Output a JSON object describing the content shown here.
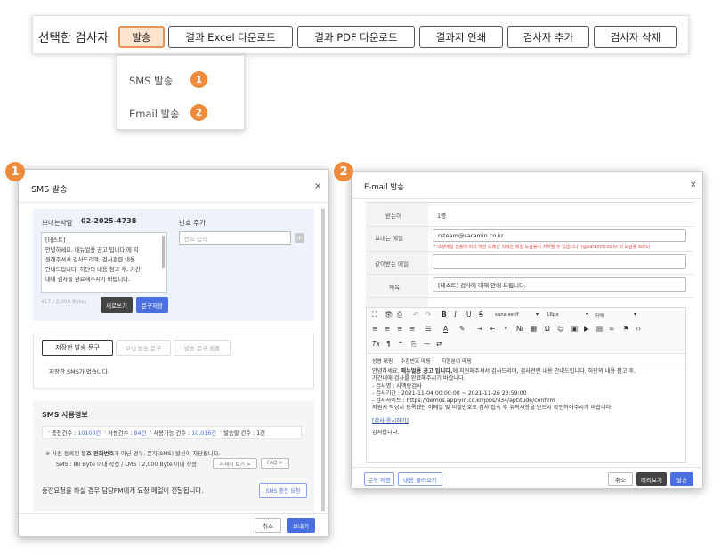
{
  "toolbar": {
    "label": "선택한 검사자",
    "buttons": [
      "발송",
      "결과 Excel 다운로드",
      "결과 PDF 다운로드",
      "결과지 인쇄",
      "검사자 추가",
      "검사자 삭제"
    ]
  },
  "send_menu": {
    "items": [
      {
        "label": "SMS 발송",
        "badge": "1"
      },
      {
        "label": "Email 발송",
        "badge": "2"
      }
    ]
  },
  "sms_dialog": {
    "badge": "1",
    "title": "SMS 발송",
    "close": "×",
    "sender_label": "보내는사람",
    "sender_number": "02-2025-4738",
    "message_lines": [
      "[테스트]",
      "안녕하세요, 매뉴얼용 공고 입니다.에 지",
      "원해주셔서 감사드리며, 검사관련 내용",
      "안내드립니다. 하단의 내용 참고 후, 기간",
      "내에 검사를 완료해주시기 바랍니다."
    ],
    "byte_count": "417 / 2,000 Bytes",
    "new_btn": "새로쓰기",
    "save_btn": "문구저장",
    "number_add_label": "번호 추가",
    "number_placeholder": "번호 입력",
    "add_icon": "+",
    "tabs": [
      "저장한 발송 문구",
      "보낸 발송 문구",
      "발송 문구 샘플"
    ],
    "no_saved": "저장한 SMS가 없습니다.",
    "info_title": "SMS 사용정보",
    "usage": {
      "charged_label": "충전건수 :",
      "charged": "10100건",
      "used_label": "사용건수 :",
      "used": "84건",
      "avail_label": "사용가능 건수 :",
      "avail": "10,016건",
      "send_label": "발송할 건수 :",
      "send": "1건"
    },
    "note_prefix": "※ 사전 등록된 ",
    "note_bold": "유효 전화번호",
    "note_suffix": "가 아닌 경우, 문자(SMS) 발신이 차단됩니다.",
    "note_line2": "SMS : 80 Byte 이내 작성 / LMS : 2,000 Byte 이내 작성",
    "detail_btn": "자세히 보기 >",
    "faq_btn": "FAQ >",
    "charge_text": "충전요청을 하실 경우 담당PM에게 요청 메일이 전달됩니다.",
    "charge_btn": "SMS 충전 요청",
    "cancel": "취소",
    "send": "보내기"
  },
  "email_dialog": {
    "badge": "2",
    "title": "E-mail 발송",
    "close": "×",
    "recipient_label": "받는이",
    "recipient_value": "1명",
    "from_label": "보내는 메일",
    "from_value": "rsteam@saramin.co.kr",
    "from_warning": "* 대량메일 전송에 따라 해당 도메인 외에는 메일 도달률이 저하될 수 있습니다. (@saramin.co.kr 외 도달률 60%)",
    "cc_label": "같이받는 메일",
    "subject_label": "제목",
    "subject_value": "[테스트] 검사에 대해 안내 드립니다.",
    "font_name": "sans-serif",
    "font_size": "16px",
    "paragraph": "단락",
    "insert_tags": [
      "성명 매핑",
      "수험번호 매핑",
      "지원분야 매핑"
    ],
    "body": {
      "p1_pre": "안녕하세요. ",
      "p1_bold": "매뉴얼용 공고 입니다.",
      "p1_post": "에 지원해주셔서 감사드리며, 검사관련 내용 안내드립니다. 하단의 내용 참고 후,",
      "p1_line2": "기간내에 검사를 완료해주시기 바랍니다.",
      "items": [
        "- 검사명 : 사맥랑검사",
        "- 검사기간 : 2021-11-04 00:00:00 ~ 2021-11-26 23:59:00",
        "- 검사사이트 : https://demos.applyin.co.kr/jobs/934/aptitude/confirm"
      ],
      "p2": "지원서 작성시 등록했던 이메일 및 비밀번호로 검사 접속 후 유의사항을 반드시 확인하여주시기 바랍니다.",
      "link": "[검사 응시하기]",
      "closing": "감사합니다."
    },
    "btn_save": "문구 저장",
    "btn_load": "내용 불러오기",
    "btn_cancel": "취소",
    "btn_preview": "미리보기",
    "btn_send": "발송"
  },
  "colors": {
    "accent": "#ee8a3b",
    "primary": "#4a6fe0",
    "dark": "#444444"
  }
}
